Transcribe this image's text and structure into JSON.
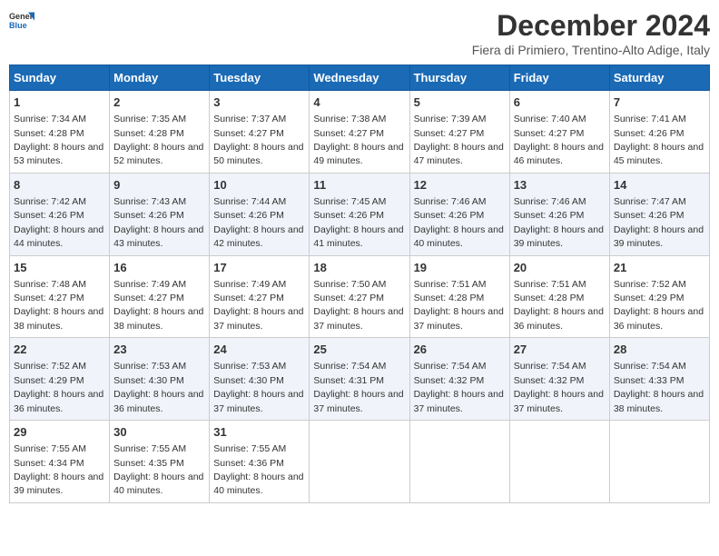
{
  "logo": {
    "general": "General",
    "blue": "Blue"
  },
  "title": "December 2024",
  "subtitle": "Fiera di Primiero, Trentino-Alto Adige, Italy",
  "headers": [
    "Sunday",
    "Monday",
    "Tuesday",
    "Wednesday",
    "Thursday",
    "Friday",
    "Saturday"
  ],
  "weeks": [
    [
      {
        "day": "1",
        "sunrise": "7:34 AM",
        "sunset": "4:28 PM",
        "daylight": "8 hours and 53 minutes."
      },
      {
        "day": "2",
        "sunrise": "7:35 AM",
        "sunset": "4:28 PM",
        "daylight": "8 hours and 52 minutes."
      },
      {
        "day": "3",
        "sunrise": "7:37 AM",
        "sunset": "4:27 PM",
        "daylight": "8 hours and 50 minutes."
      },
      {
        "day": "4",
        "sunrise": "7:38 AM",
        "sunset": "4:27 PM",
        "daylight": "8 hours and 49 minutes."
      },
      {
        "day": "5",
        "sunrise": "7:39 AM",
        "sunset": "4:27 PM",
        "daylight": "8 hours and 47 minutes."
      },
      {
        "day": "6",
        "sunrise": "7:40 AM",
        "sunset": "4:27 PM",
        "daylight": "8 hours and 46 minutes."
      },
      {
        "day": "7",
        "sunrise": "7:41 AM",
        "sunset": "4:26 PM",
        "daylight": "8 hours and 45 minutes."
      }
    ],
    [
      {
        "day": "8",
        "sunrise": "7:42 AM",
        "sunset": "4:26 PM",
        "daylight": "8 hours and 44 minutes."
      },
      {
        "day": "9",
        "sunrise": "7:43 AM",
        "sunset": "4:26 PM",
        "daylight": "8 hours and 43 minutes."
      },
      {
        "day": "10",
        "sunrise": "7:44 AM",
        "sunset": "4:26 PM",
        "daylight": "8 hours and 42 minutes."
      },
      {
        "day": "11",
        "sunrise": "7:45 AM",
        "sunset": "4:26 PM",
        "daylight": "8 hours and 41 minutes."
      },
      {
        "day": "12",
        "sunrise": "7:46 AM",
        "sunset": "4:26 PM",
        "daylight": "8 hours and 40 minutes."
      },
      {
        "day": "13",
        "sunrise": "7:46 AM",
        "sunset": "4:26 PM",
        "daylight": "8 hours and 39 minutes."
      },
      {
        "day": "14",
        "sunrise": "7:47 AM",
        "sunset": "4:26 PM",
        "daylight": "8 hours and 39 minutes."
      }
    ],
    [
      {
        "day": "15",
        "sunrise": "7:48 AM",
        "sunset": "4:27 PM",
        "daylight": "8 hours and 38 minutes."
      },
      {
        "day": "16",
        "sunrise": "7:49 AM",
        "sunset": "4:27 PM",
        "daylight": "8 hours and 38 minutes."
      },
      {
        "day": "17",
        "sunrise": "7:49 AM",
        "sunset": "4:27 PM",
        "daylight": "8 hours and 37 minutes."
      },
      {
        "day": "18",
        "sunrise": "7:50 AM",
        "sunset": "4:27 PM",
        "daylight": "8 hours and 37 minutes."
      },
      {
        "day": "19",
        "sunrise": "7:51 AM",
        "sunset": "4:28 PM",
        "daylight": "8 hours and 37 minutes."
      },
      {
        "day": "20",
        "sunrise": "7:51 AM",
        "sunset": "4:28 PM",
        "daylight": "8 hours and 36 minutes."
      },
      {
        "day": "21",
        "sunrise": "7:52 AM",
        "sunset": "4:29 PM",
        "daylight": "8 hours and 36 minutes."
      }
    ],
    [
      {
        "day": "22",
        "sunrise": "7:52 AM",
        "sunset": "4:29 PM",
        "daylight": "8 hours and 36 minutes."
      },
      {
        "day": "23",
        "sunrise": "7:53 AM",
        "sunset": "4:30 PM",
        "daylight": "8 hours and 36 minutes."
      },
      {
        "day": "24",
        "sunrise": "7:53 AM",
        "sunset": "4:30 PM",
        "daylight": "8 hours and 37 minutes."
      },
      {
        "day": "25",
        "sunrise": "7:54 AM",
        "sunset": "4:31 PM",
        "daylight": "8 hours and 37 minutes."
      },
      {
        "day": "26",
        "sunrise": "7:54 AM",
        "sunset": "4:32 PM",
        "daylight": "8 hours and 37 minutes."
      },
      {
        "day": "27",
        "sunrise": "7:54 AM",
        "sunset": "4:32 PM",
        "daylight": "8 hours and 37 minutes."
      },
      {
        "day": "28",
        "sunrise": "7:54 AM",
        "sunset": "4:33 PM",
        "daylight": "8 hours and 38 minutes."
      }
    ],
    [
      {
        "day": "29",
        "sunrise": "7:55 AM",
        "sunset": "4:34 PM",
        "daylight": "8 hours and 39 minutes."
      },
      {
        "day": "30",
        "sunrise": "7:55 AM",
        "sunset": "4:35 PM",
        "daylight": "8 hours and 40 minutes."
      },
      {
        "day": "31",
        "sunrise": "7:55 AM",
        "sunset": "4:36 PM",
        "daylight": "8 hours and 40 minutes."
      },
      null,
      null,
      null,
      null
    ]
  ]
}
